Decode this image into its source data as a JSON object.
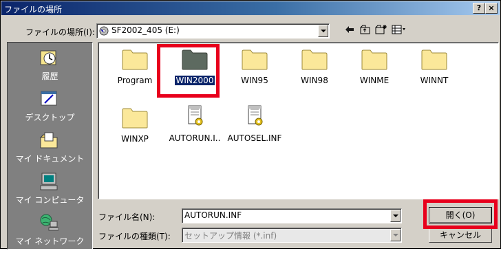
{
  "window": {
    "title": "ファイルの場所",
    "help_button": "?",
    "close_button": "×"
  },
  "location": {
    "label": "ファイルの場所(I):",
    "value": "SF2002_405 (E:)"
  },
  "toolbar": {
    "back_icon": "back-arrow-icon",
    "up_icon": "up-folder-icon",
    "new_folder_icon": "new-folder-icon",
    "view_icon": "view-menu-icon"
  },
  "places": [
    {
      "label": "履歴",
      "icon": "history-icon"
    },
    {
      "label": "デスクトップ",
      "icon": "desktop-icon"
    },
    {
      "label": "マイ ドキュメント",
      "icon": "my-documents-icon"
    },
    {
      "label": "マイ コンピュータ",
      "icon": "my-computer-icon"
    },
    {
      "label": "マイ ネットワーク",
      "icon": "my-network-icon"
    }
  ],
  "files": [
    {
      "name": "Program",
      "type": "folder"
    },
    {
      "name": "WIN2000",
      "type": "folder",
      "selected": true
    },
    {
      "name": "WIN95",
      "type": "folder"
    },
    {
      "name": "WIN98",
      "type": "folder"
    },
    {
      "name": "WINME",
      "type": "folder"
    },
    {
      "name": "WINNT",
      "type": "folder"
    },
    {
      "name": "WINXP",
      "type": "folder"
    },
    {
      "name": "AUTORUN.I..",
      "type": "inf"
    },
    {
      "name": "AUTOSEL.INF",
      "type": "inf"
    }
  ],
  "filename": {
    "label": "ファイル名(N):",
    "value": "AUTORUN.INF"
  },
  "filetype": {
    "label": "ファイルの種類(T):",
    "value": "セットアップ情報 (*.inf)"
  },
  "buttons": {
    "open": "開く(O)",
    "cancel": "キャンセル"
  },
  "colors": {
    "highlight": "#e8001c",
    "selection": "#0a246a",
    "folder": "#fbe89a"
  }
}
